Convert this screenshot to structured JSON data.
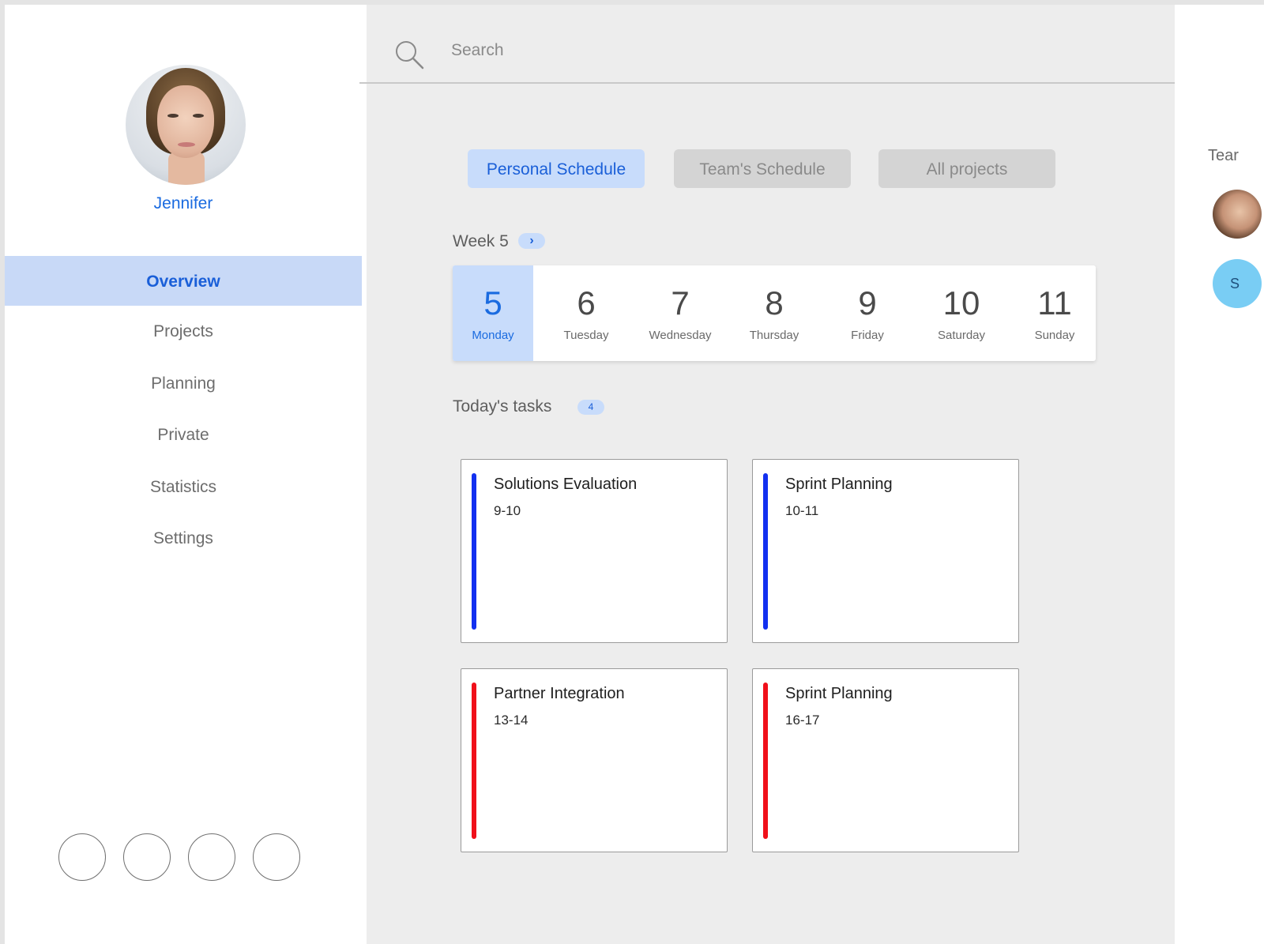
{
  "user": {
    "name": "Jennifer"
  },
  "nav": {
    "items": [
      {
        "label": "Overview",
        "active": true
      },
      {
        "label": "Projects"
      },
      {
        "label": "Planning"
      },
      {
        "label": "Private"
      },
      {
        "label": "Statistics"
      },
      {
        "label": "Settings"
      }
    ]
  },
  "search": {
    "placeholder": "Search"
  },
  "tabs": [
    {
      "label": "Personal Schedule",
      "active": true
    },
    {
      "label": "Team's Schedule"
    },
    {
      "label": "All projects"
    }
  ],
  "week": {
    "label": "Week 5",
    "next_icon": "chevron-right-icon",
    "days": [
      {
        "num": "5",
        "name": "Monday",
        "active": true
      },
      {
        "num": "6",
        "name": "Tuesday"
      },
      {
        "num": "7",
        "name": "Wednesday"
      },
      {
        "num": "8",
        "name": "Thursday"
      },
      {
        "num": "9",
        "name": "Friday"
      },
      {
        "num": "10",
        "name": "Saturday"
      },
      {
        "num": "11",
        "name": "Sunday"
      }
    ]
  },
  "tasks": {
    "label": "Today's tasks",
    "count": "4",
    "items": [
      {
        "title": "Solutions Evaluation",
        "time": "9-10",
        "color": "#1230f0"
      },
      {
        "title": "Sprint Planning",
        "time": "10-11",
        "color": "#1230f0"
      },
      {
        "title": "Partner Integration",
        "time": "13-14",
        "color": "#f0101a"
      },
      {
        "title": "Sprint Planning",
        "time": "16-17",
        "color": "#f0101a"
      }
    ]
  },
  "team": {
    "label": "Tear",
    "badge": "S"
  },
  "colors": {
    "accent": "#1a6be0",
    "accent_light": "#c8dcfb",
    "badge": "#79cdf4"
  }
}
